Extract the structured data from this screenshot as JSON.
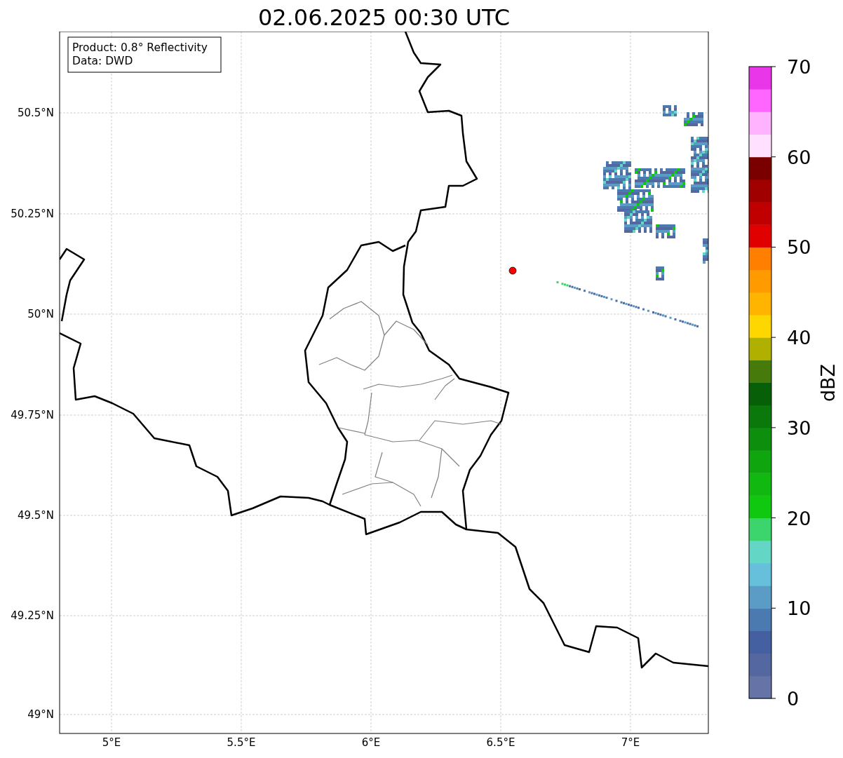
{
  "title": "02.06.2025 00:30 UTC",
  "map": {
    "info_box": [
      "Product: 0.8° Reflectivity",
      "Data: DWD"
    ],
    "y_ticks": [
      "50.5°N",
      "50.25°N",
      "50°N",
      "49.75°N",
      "49.5°N",
      "49.25°N",
      "49°N"
    ],
    "x_ticks": [
      "5°E",
      "5.5°E",
      "6°E",
      "6.5°E",
      "7°E"
    ]
  },
  "colorbar": {
    "label": "dBZ",
    "ticks": [
      "70",
      "60",
      "50",
      "40",
      "30",
      "20",
      "10",
      "0"
    ],
    "bins": [
      {
        "color": "#6673a6"
      },
      {
        "color": "#5467a0"
      },
      {
        "color": "#4560a0"
      },
      {
        "color": "#4b7ab0"
      },
      {
        "color": "#5a9cc6"
      },
      {
        "color": "#66c0dc"
      },
      {
        "color": "#63d6c6"
      },
      {
        "color": "#3cd46c"
      },
      {
        "color": "#10c810"
      },
      {
        "color": "#10b810"
      },
      {
        "color": "#0fa50f"
      },
      {
        "color": "#0d8f0d"
      },
      {
        "color": "#0a780a"
      },
      {
        "color": "#075f07"
      },
      {
        "color": "#467a0a"
      },
      {
        "color": "#b0b000"
      },
      {
        "color": "#ffd700"
      },
      {
        "color": "#ffb400"
      },
      {
        "color": "#ff9b00"
      },
      {
        "color": "#ff7f00"
      },
      {
        "color": "#e00000"
      },
      {
        "color": "#c00000"
      },
      {
        "color": "#a00000"
      },
      {
        "color": "#7a0000"
      },
      {
        "color": "#ffe0ff"
      },
      {
        "color": "#ffb3ff"
      },
      {
        "color": "#ff66ff"
      },
      {
        "color": "#e836e8"
      }
    ]
  }
}
